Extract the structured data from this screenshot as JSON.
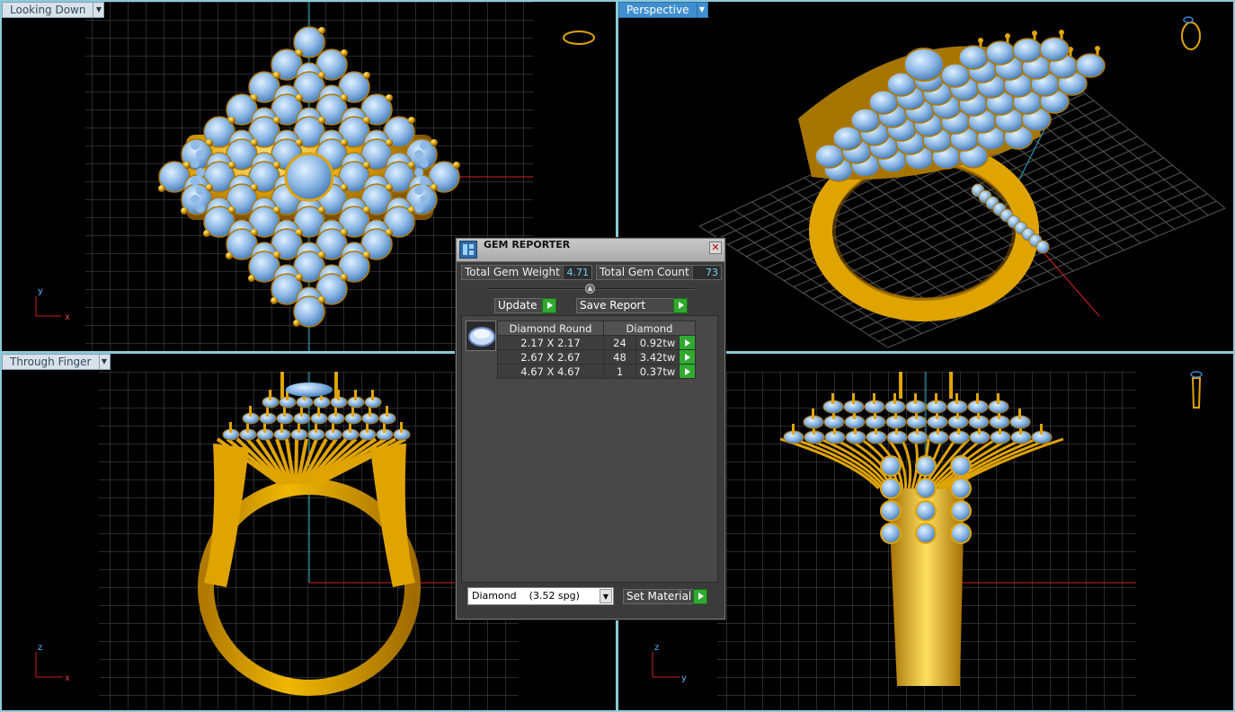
{
  "viewports": {
    "top_left": {
      "label": "Looking Down",
      "axis_1": "y",
      "axis_2": "x"
    },
    "top_right": {
      "label": "Perspective"
    },
    "bottom_left": {
      "label": "Through Finger",
      "axis_1": "z",
      "axis_2": "x"
    },
    "bottom_right": {
      "axis_1": "z",
      "axis_2": "y"
    }
  },
  "gem_reporter": {
    "title": "GEM REPORTER",
    "total_gem_weight_label": "Total Gem Weight",
    "total_gem_weight_value": "4.71",
    "total_gem_count_label": "Total Gem Count",
    "total_gem_count_value": "73",
    "update_label": "Update",
    "save_report_label": "Save Report",
    "table": {
      "header_shape": "Diamond Round",
      "header_material": "Diamond",
      "rows": [
        {
          "size": "2.17 X 2.17",
          "count": "24",
          "weight": "0.92tw"
        },
        {
          "size": "2.67 X 2.67",
          "count": "48",
          "weight": "3.42tw"
        },
        {
          "size": "4.67 X 4.67",
          "count": "1",
          "weight": "0.37tw"
        }
      ]
    },
    "material_select_value": "Diamond    (3.52 spg)",
    "set_material_label": "Set Material"
  },
  "colors": {
    "gold": "#e0a400",
    "gem": "#8fb9e6",
    "grid": "#5a5a5a",
    "active_tab": "#3f8fd0",
    "go_button": "#2faa2f"
  }
}
